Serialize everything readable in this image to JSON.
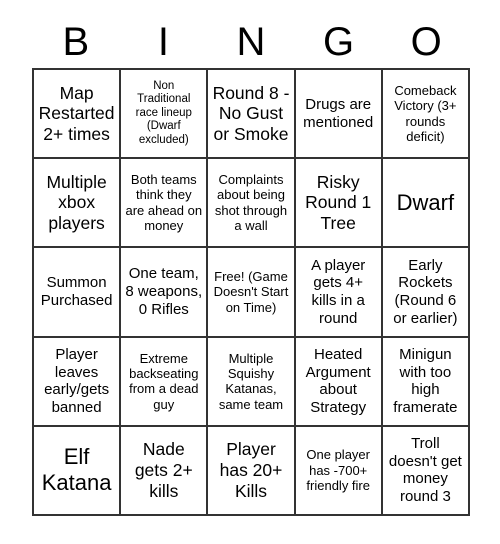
{
  "card": {
    "title": "BINGO",
    "header_letters": [
      "B",
      "I",
      "N",
      "G",
      "O"
    ],
    "columns": 5,
    "rows": 5,
    "border_color": "#333333",
    "background_color": "#ffffff",
    "text_color": "#000000",
    "cells": [
      {
        "id": "b1",
        "text": "Map Restarted 2+ times",
        "size": "l"
      },
      {
        "id": "i1",
        "text": "Non Traditional race lineup (Dwarf excluded)",
        "size": "xs"
      },
      {
        "id": "n1",
        "text": "Round 8 - No Gust or Smoke",
        "size": "l"
      },
      {
        "id": "g1",
        "text": "Drugs are mentioned",
        "size": "m"
      },
      {
        "id": "o1",
        "text": "Comeback Victory (3+ rounds deficit)",
        "size": "s"
      },
      {
        "id": "b2",
        "text": "Multiple xbox players",
        "size": "l"
      },
      {
        "id": "i2",
        "text": "Both teams think they are ahead on money",
        "size": "s"
      },
      {
        "id": "n2",
        "text": "Complaints about being shot through a wall",
        "size": "s"
      },
      {
        "id": "g2",
        "text": "Risky Round 1 Tree",
        "size": "l"
      },
      {
        "id": "o2",
        "text": "Dwarf",
        "size": "xl"
      },
      {
        "id": "b3",
        "text": "Summon Purchased",
        "size": "m"
      },
      {
        "id": "i3",
        "text": "One team, 8 weapons, 0 Rifles",
        "size": "m"
      },
      {
        "id": "n3",
        "text": "Free! (Game Doesn't Start on Time)",
        "size": "s"
      },
      {
        "id": "g3",
        "text": "A player gets 4+ kills in a round",
        "size": "m"
      },
      {
        "id": "o3",
        "text": "Early Rockets (Round 6 or earlier)",
        "size": "m"
      },
      {
        "id": "b4",
        "text": "Player leaves early/gets banned",
        "size": "m"
      },
      {
        "id": "i4",
        "text": "Extreme backseating from a dead guy",
        "size": "s"
      },
      {
        "id": "n4",
        "text": "Multiple Squishy Katanas, same team",
        "size": "s"
      },
      {
        "id": "g4",
        "text": "Heated Argument about Strategy",
        "size": "m"
      },
      {
        "id": "o4",
        "text": "Minigun with too high framerate",
        "size": "m"
      },
      {
        "id": "b5",
        "text": "Elf Katana",
        "size": "xl"
      },
      {
        "id": "i5",
        "text": "Nade gets 2+ kills",
        "size": "l"
      },
      {
        "id": "n5",
        "text": "Player has 20+ Kills",
        "size": "l"
      },
      {
        "id": "g5",
        "text": "One player has -700+ friendly fire",
        "size": "s"
      },
      {
        "id": "o5",
        "text": "Troll doesn't get money round 3",
        "size": "m"
      }
    ]
  }
}
